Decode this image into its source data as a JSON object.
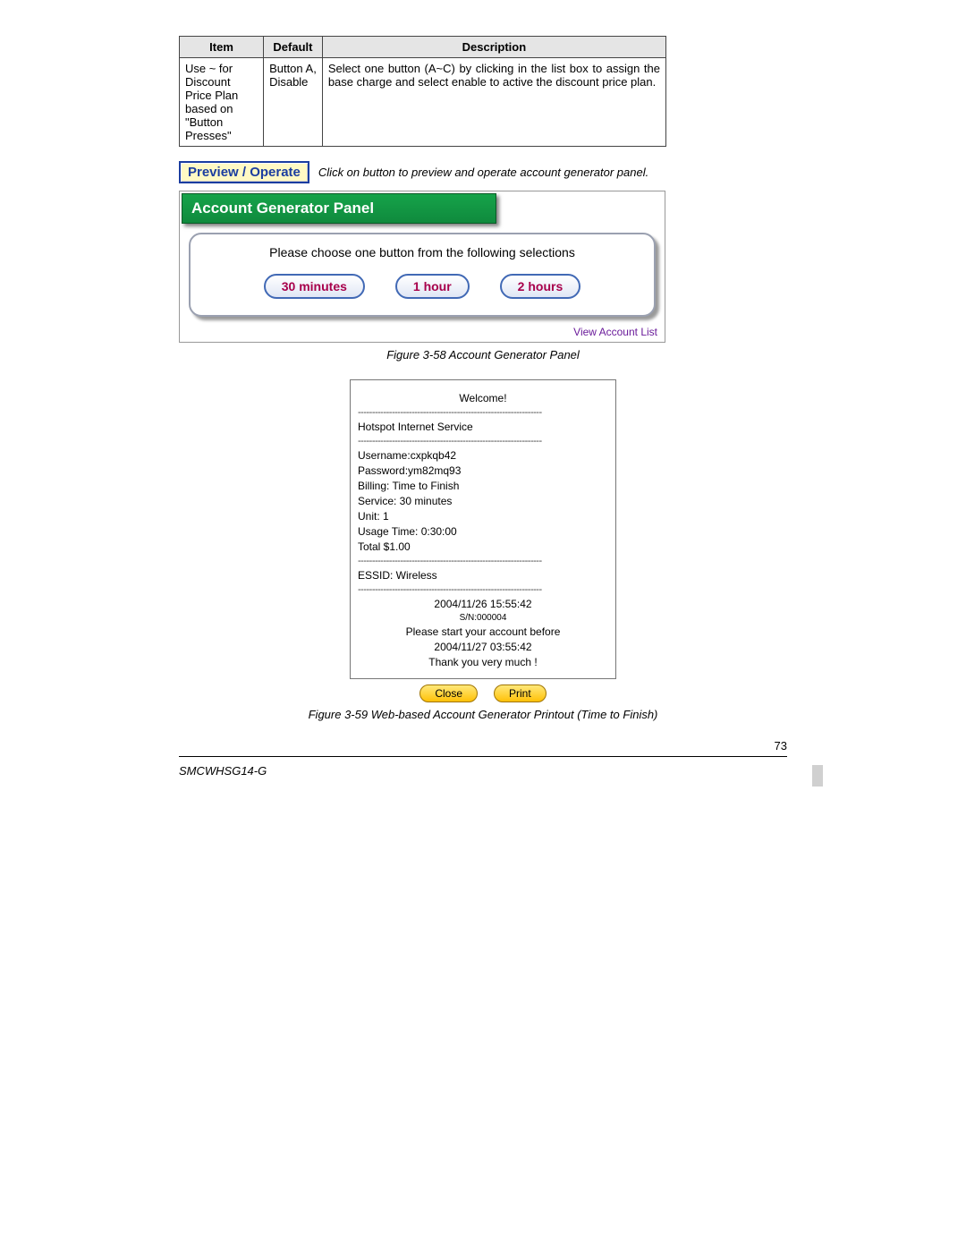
{
  "table": {
    "headers": [
      "Item",
      "Default",
      "Description"
    ],
    "row": {
      "item_l1": "Use ~ for Discount",
      "item_l2": "Price Plan based on",
      "item_l3": "\"Button Presses\"",
      "default_l1": "Button A,",
      "default_l2": "Disable",
      "desc": "Select one button (A~C) by clicking in the list box to assign the base charge and select enable to active the discount price plan."
    }
  },
  "preview": {
    "button": "Preview / Operate",
    "caption": "Click on button to preview and operate account generator panel."
  },
  "panel": {
    "title": "Account Generator Panel",
    "prompt": "Please choose one button from the following selections",
    "buttons": [
      "30 minutes",
      "1 hour",
      "2 hours"
    ],
    "view_list": "View Account List"
  },
  "figure1": "Figure 3-58 Account Generator Panel",
  "ticket": {
    "welcome": "Welcome!",
    "service_name": "Hotspot Internet Service",
    "username": "Username:cxpkqb42",
    "password": "Password:ym82mq93",
    "billing": "Billing: Time to Finish",
    "service": "Service: 30 minutes",
    "unit": "Unit: 1",
    "usage": "Usage Time: 0:30:00",
    "total": "Total $1.00",
    "essid": "ESSID: Wireless",
    "timestamp": "2004/11/26 15:55:42",
    "sn": "S/N:000004",
    "start_before_l1": "Please start your account before",
    "start_before_l2": "2004/11/27 03:55:42",
    "thanks": "Thank you very much !",
    "close": "Close",
    "print": "Print"
  },
  "figure2": "Figure 3-59 Web-based Account Generator Printout (Time to Finish)",
  "page_num": "73",
  "model": "SMCWHSG14-G",
  "dashes": "-----------------------------------------------------------------"
}
